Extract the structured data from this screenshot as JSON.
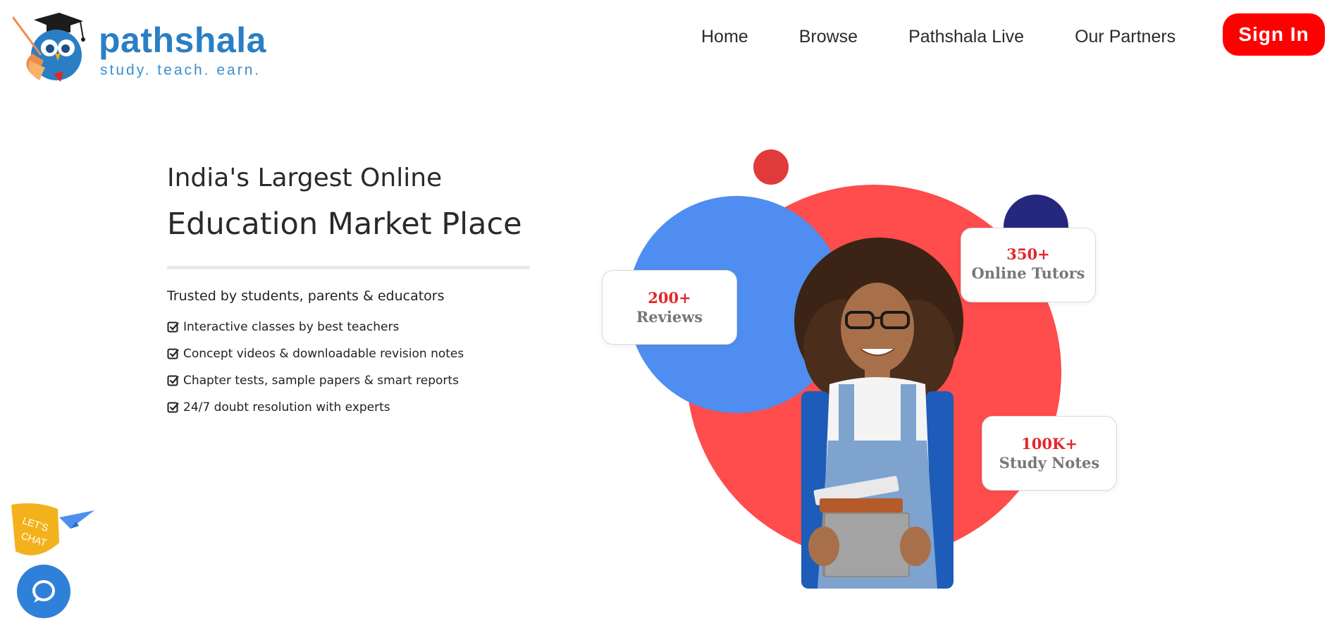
{
  "brand": {
    "name": "pathshala",
    "tagline": "study. teach. earn."
  },
  "nav": {
    "items": [
      "Home",
      "Browse",
      "Pathshala Live",
      "Our Partners"
    ],
    "signin_label": "Sign In"
  },
  "hero": {
    "heading_line1": "India's Largest Online",
    "heading_line2": "Education Market Place",
    "trusted": "Trusted by students, parents & educators",
    "features": [
      "Interactive classes by best teachers",
      "Concept videos & downloadable revision notes",
      "Chapter tests, sample papers & smart reports",
      "24/7 doubt resolution with experts"
    ]
  },
  "stats": [
    {
      "number": "200+",
      "label": "Reviews"
    },
    {
      "number": "350+",
      "label": "Online Tutors"
    },
    {
      "number": "100K+",
      "label": "Study Notes"
    }
  ],
  "chat": {
    "badge_line1": "LET'S",
    "badge_line2": "CHAT"
  },
  "colors": {
    "brand_blue": "#2a7fc4",
    "signin_red": "#ff0000",
    "circle_red": "#ff4c4c",
    "circle_blue": "#4f8ef0",
    "circle_navy": "#26287f",
    "dot_red": "#e03a3a",
    "stat_red": "#e3262a",
    "chat_blue": "#2f80d8",
    "chat_yellow": "#f3b21c"
  }
}
